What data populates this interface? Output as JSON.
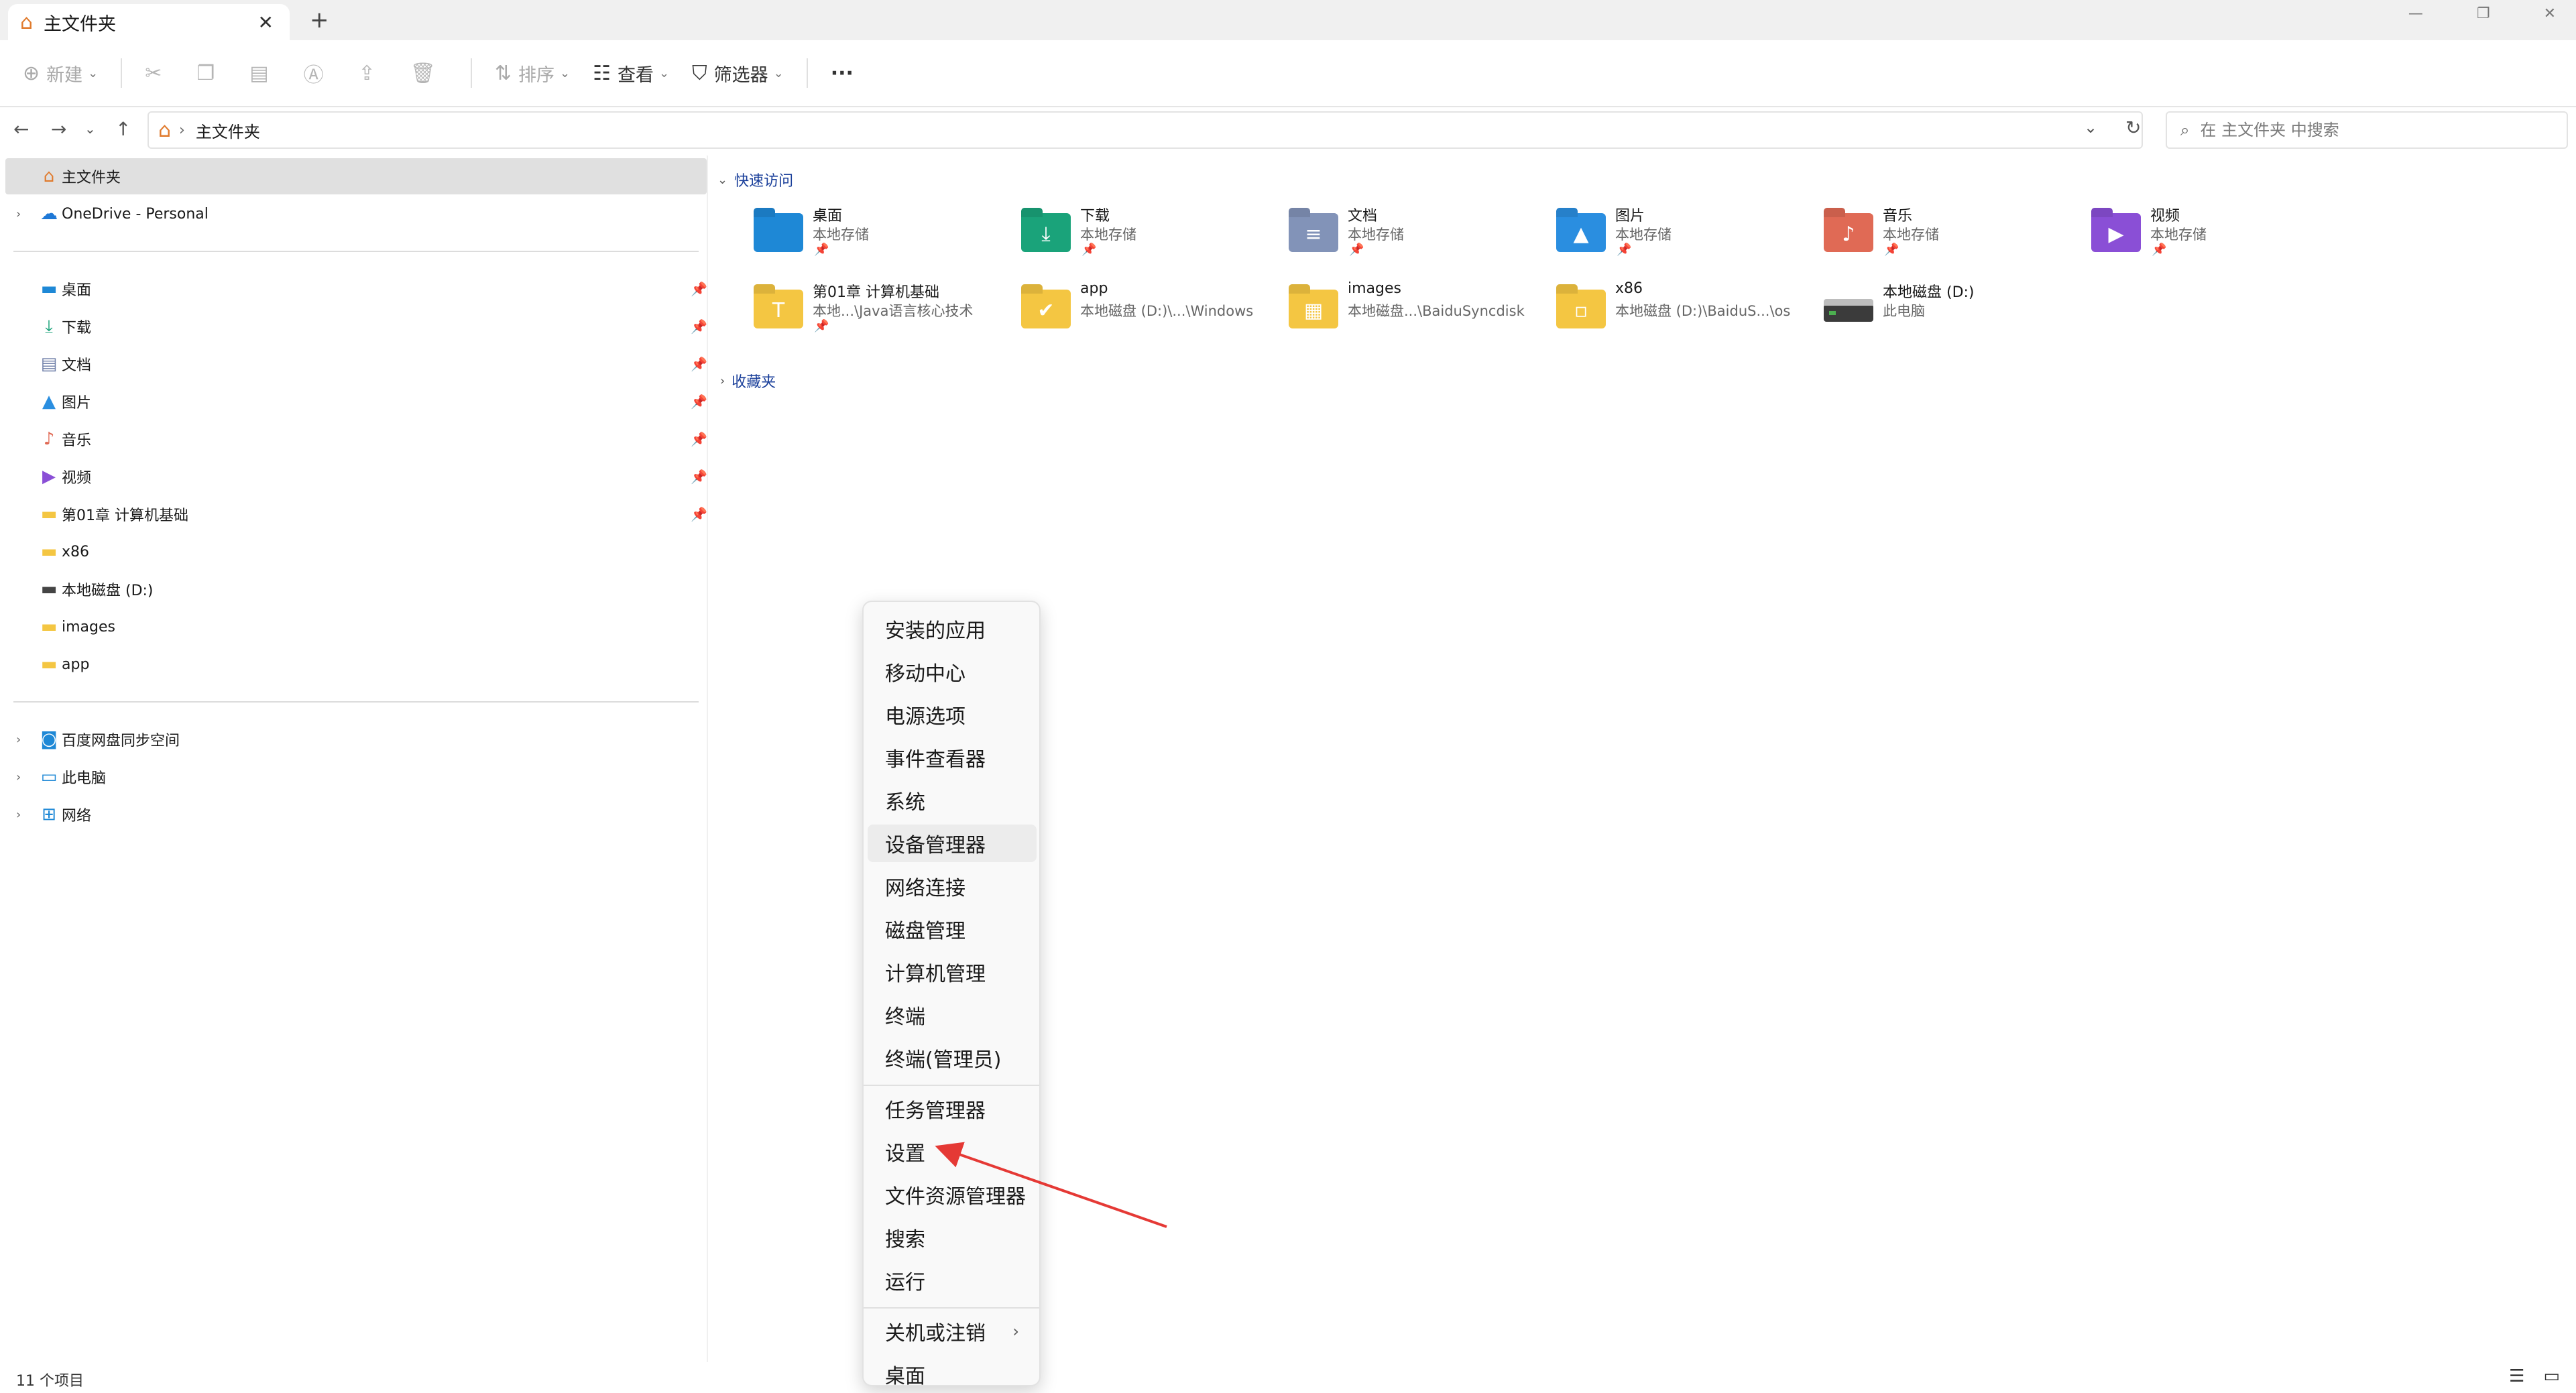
{
  "window": {
    "tab_title": "主文件夹",
    "tab_close": "✕",
    "new_tab": "+"
  },
  "toolbar": {
    "new_label": "新建",
    "sort_label": "排序",
    "view_label": "查看",
    "filter_label": "筛选器",
    "more_label": "···"
  },
  "address": {
    "crumb": "主文件夹",
    "search_placeholder": "在 主文件夹 中搜索"
  },
  "sidebar": {
    "top": [
      {
        "label": "主文件夹",
        "icon": "home-icon"
      },
      {
        "label": "OneDrive - Personal",
        "icon": "cloud-icon"
      }
    ],
    "pinned": [
      {
        "label": "桌面",
        "icon": "desktop-icon",
        "pinned": true
      },
      {
        "label": "下载",
        "icon": "download-icon",
        "pinned": true
      },
      {
        "label": "文档",
        "icon": "document-icon",
        "pinned": true
      },
      {
        "label": "图片",
        "icon": "pictures-icon",
        "pinned": true
      },
      {
        "label": "音乐",
        "icon": "music-icon",
        "pinned": true
      },
      {
        "label": "视频",
        "icon": "video-icon",
        "pinned": true
      },
      {
        "label": "第01章 计算机基础",
        "icon": "folder-icon",
        "pinned": true
      },
      {
        "label": "x86",
        "icon": "folder-icon",
        "pinned": false
      },
      {
        "label": "本地磁盘 (D:)",
        "icon": "drive-icon",
        "pinned": false
      },
      {
        "label": "images",
        "icon": "folder-icon",
        "pinned": false
      },
      {
        "label": "app",
        "icon": "folder-icon",
        "pinned": false
      }
    ],
    "bottom": [
      {
        "label": "百度网盘同步空间",
        "icon": "baidu-sync-icon"
      },
      {
        "label": "此电脑",
        "icon": "computer-icon"
      },
      {
        "label": "网络",
        "icon": "network-icon"
      }
    ]
  },
  "content": {
    "quick_access_label": "快速访问",
    "favorites_label": "收藏夹",
    "row1": [
      {
        "name": "桌面",
        "sub": "本地存储",
        "color": "#1e88d6",
        "glyph": ""
      },
      {
        "name": "下载",
        "sub": "本地存储",
        "color": "#1aa37a",
        "glyph": "⤓"
      },
      {
        "name": "文档",
        "sub": "本地存储",
        "color": "#8293b8",
        "glyph": "≡"
      },
      {
        "name": "图片",
        "sub": "本地存储",
        "color": "#2a8ee0",
        "glyph": "▲"
      },
      {
        "name": "音乐",
        "sub": "本地存储",
        "color": "#e06a55",
        "glyph": "♪"
      },
      {
        "name": "视频",
        "sub": "本地存储",
        "color": "#8a4fd6",
        "glyph": "▶"
      }
    ],
    "row2": [
      {
        "name": "第01章 计算机基础",
        "sub": "本地...\\Java语言核心技术",
        "color": "#f4c642",
        "glyph": "T"
      },
      {
        "name": "app",
        "sub": "本地磁盘 (D:)\\...\\Windows",
        "color": "#f4c642",
        "glyph": "✔"
      },
      {
        "name": "images",
        "sub": "本地磁盘...\\BaiduSyncdisk",
        "color": "#f4c642",
        "glyph": "▦"
      },
      {
        "name": "x86",
        "sub": "本地磁盘 (D:)\\BaiduS...\\os",
        "color": "#f4c642",
        "glyph": "▫"
      },
      {
        "name": "本地磁盘 (D:)",
        "sub": "此电脑",
        "color": "#444444",
        "glyph": ""
      }
    ]
  },
  "context_menu": {
    "groups": [
      [
        "安装的应用",
        "移动中心",
        "电源选项",
        "事件查看器",
        "系统",
        "设备管理器",
        "网络连接",
        "磁盘管理",
        "计算机管理",
        "终端",
        "终端(管理员)"
      ],
      [
        "任务管理器",
        "设置",
        "文件资源管理器",
        "搜索",
        "运行"
      ],
      [
        "关机或注销",
        "桌面"
      ]
    ],
    "hover_item": "设备管理器",
    "submenu_item": "关机或注销"
  },
  "status": {
    "item_count": "11 个项目"
  },
  "colors": {
    "accent": "#1a3f9a",
    "arrow": "#e53935",
    "folder": "#f4c642"
  }
}
